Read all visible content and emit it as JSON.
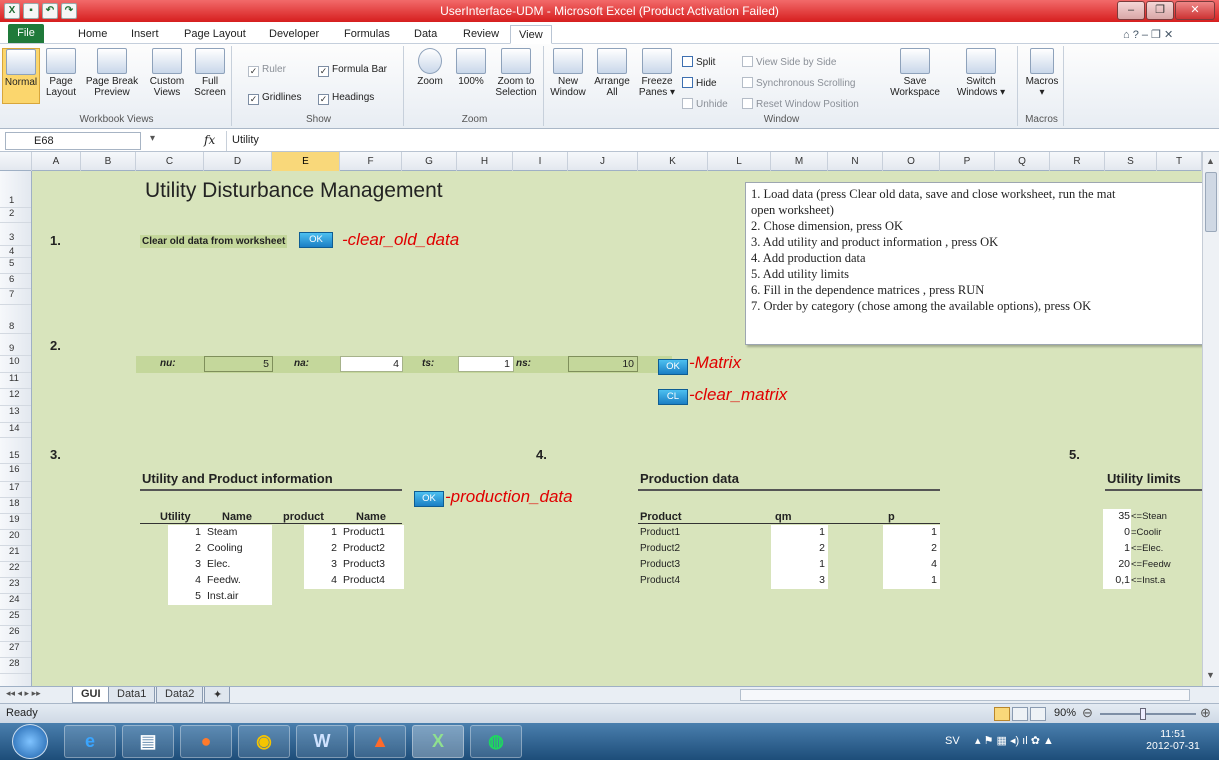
{
  "window": {
    "title": "UserInterface-UDM - Microsoft Excel (Product Activation Failed)",
    "controls": [
      "–",
      "❐",
      "✕"
    ]
  },
  "tabs": [
    "File",
    "Home",
    "Insert",
    "Page Layout",
    "Developer",
    "Formulas",
    "Data",
    "Review",
    "View"
  ],
  "tab_icons": "⌂ ? – ❐ ✕",
  "ribbon": {
    "workbook_views": {
      "label": "Workbook Views",
      "normal": "Normal",
      "page_layout": [
        "Page",
        "Layout"
      ],
      "page_break": [
        "Page Break",
        "Preview"
      ],
      "custom": [
        "Custom",
        "Views"
      ],
      "full": [
        "Full",
        "Screen"
      ]
    },
    "show": {
      "label": "Show",
      "ruler": "Ruler",
      "formula_bar": "Formula Bar",
      "gridlines": "Gridlines",
      "headings": "Headings"
    },
    "zoom": {
      "label": "Zoom",
      "zoom": "Zoom",
      "hundred": "100%",
      "zoom_sel": [
        "Zoom to",
        "Selection"
      ]
    },
    "window": {
      "label": "Window",
      "new_window": [
        "New",
        "Window"
      ],
      "arrange": [
        "Arrange",
        "All"
      ],
      "freeze": [
        "Freeze",
        "Panes ▾"
      ],
      "split": "Split",
      "hide": "Hide",
      "unhide": "Unhide",
      "side": "View Side by Side",
      "sync": "Synchronous Scrolling",
      "reset": "Reset Window Position",
      "save_ws": [
        "Save",
        "Workspace"
      ],
      "switch": [
        "Switch",
        "Windows ▾"
      ]
    },
    "macros": {
      "label": "Macros",
      "macros": "Macros"
    }
  },
  "formula_bar": {
    "name_box": "E68",
    "fx": "fx",
    "value": "Utility"
  },
  "columns": [
    "A",
    "B",
    "C",
    "D",
    "E",
    "F",
    "G",
    "H",
    "I",
    "J",
    "K",
    "L",
    "M",
    "N",
    "O",
    "P",
    "Q",
    "R",
    "S",
    "T"
  ],
  "rows": [
    "1",
    "2",
    "3",
    "4",
    "5",
    "6",
    "7",
    "8",
    "9",
    "10",
    "11",
    "12",
    "13",
    "14",
    "15",
    "16",
    "17",
    "18",
    "19",
    "20",
    "21",
    "22",
    "23",
    "24",
    "25",
    "26",
    "27",
    "28"
  ],
  "sheet": {
    "title": "Utility Disturbance Management",
    "step1": "1.",
    "step2": "2.",
    "step3": "3.",
    "step4": "4.",
    "step5": "5.",
    "clear_old_label": "Clear old data from worksheet",
    "ok": "OK",
    "cl": "CL",
    "clear_old_macro": "-clear_old_data",
    "matrix_macro": "-Matrix",
    "clear_matrix_macro": "-clear_matrix",
    "production_macro": "-production_data",
    "params": [
      {
        "label": "nu:",
        "value": "5"
      },
      {
        "label": "na:",
        "value": "4"
      },
      {
        "label": "ts:",
        "value": "1"
      },
      {
        "label": "ns:",
        "value": "10"
      }
    ],
    "instructions": [
      "1. Load data (press Clear old data, save and close worksheet, run the mat",
      "open worksheet)",
      "2. Chose dimension, press OK",
      "3. Add utility and product information , press OK",
      "4. Add production data",
      "5. Add utility limits",
      "6. Fill in the dependence matrices , press RUN",
      "7. Order by category (chose among the available options), press OK"
    ],
    "utility_product": {
      "heading": "Utility and Product information",
      "headers": [
        "Utility",
        "Name",
        "product",
        "Name"
      ],
      "utilities": [
        {
          "num": "1",
          "name": "Steam"
        },
        {
          "num": "2",
          "name": "Cooling"
        },
        {
          "num": "3",
          "name": "Elec."
        },
        {
          "num": "4",
          "name": "Feedw."
        },
        {
          "num": "5",
          "name": "Inst.air"
        }
      ],
      "products": [
        {
          "num": "1",
          "name": "Product1"
        },
        {
          "num": "2",
          "name": "Product2"
        },
        {
          "num": "3",
          "name": "Product3"
        },
        {
          "num": "4",
          "name": "Product4"
        }
      ]
    },
    "production": {
      "heading": "Production data",
      "headers": [
        "Product",
        "qm",
        "p"
      ],
      "rows": [
        {
          "product": "Product1",
          "qm": "1",
          "p": "1"
        },
        {
          "product": "Product2",
          "qm": "2",
          "p": "2"
        },
        {
          "product": "Product3",
          "qm": "1",
          "p": "4"
        },
        {
          "product": "Product4",
          "qm": "3",
          "p": "1"
        }
      ]
    },
    "limits": {
      "heading": "Utility limits",
      "rows": [
        {
          "value": "35",
          "label": "<=Stean"
        },
        {
          "value": "0",
          "label": "=Coolir"
        },
        {
          "value": "1",
          "label": "<=Elec."
        },
        {
          "value": "20",
          "label": "<=Feedw"
        },
        {
          "value": "0,1",
          "label": "<=Inst.a"
        }
      ]
    }
  },
  "sheet_tabs": [
    "GUI",
    "Data1",
    "Data2"
  ],
  "sheet_nav": "◂◂ ◂ ▸ ▸▸",
  "status": {
    "ready": "Ready",
    "zoom": "90%"
  },
  "taskbar": {
    "lang": "SV",
    "time": "11:51",
    "date": "2012-07-31"
  },
  "colors": {
    "title_bar": "#d61e1e",
    "sheet_bg": "#d8e4bc",
    "ok_button": "#1a7fc4",
    "macro_text": "#e00000"
  }
}
